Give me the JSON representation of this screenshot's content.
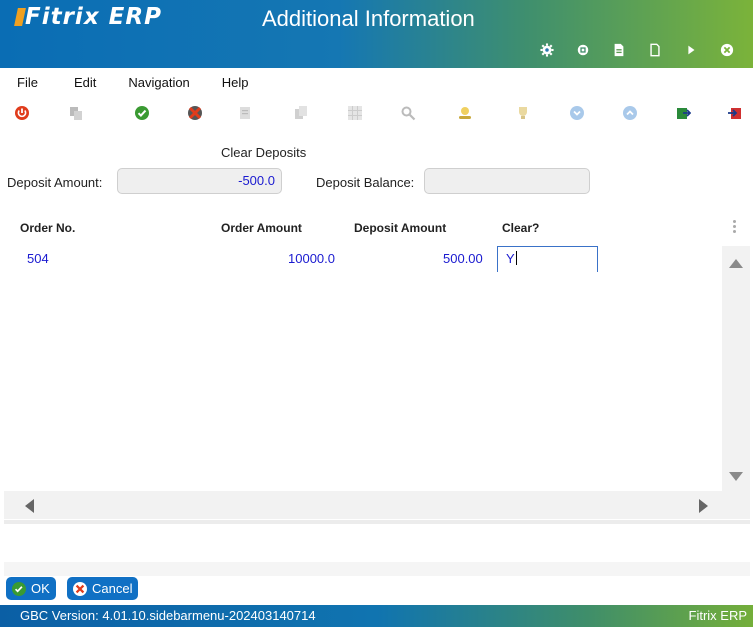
{
  "app": {
    "logo_text": "Fitrix ERP",
    "window_title": "Additional Information",
    "header_icons": [
      "gear-icon",
      "chip-icon",
      "document-filled-icon",
      "document-icon",
      "play-icon",
      "close-circle-icon"
    ]
  },
  "menu": {
    "items": [
      "File",
      "Edit",
      "Navigation",
      "Help"
    ]
  },
  "toolbar": {
    "buttons": [
      "power-icon",
      "copy-disabled-icon",
      "accept-icon",
      "cancel-icon",
      "paste-icon",
      "duplicate-icon",
      "grid-icon",
      "find-icon",
      "user-icon",
      "trophy-icon",
      "circle-down-icon",
      "circle-up-icon",
      "export-icon",
      "import-icon"
    ]
  },
  "form": {
    "section_title": "Clear Deposits",
    "deposit_amount_label": "Deposit Amount:",
    "deposit_amount_value": "-500.0",
    "deposit_balance_label": "Deposit Balance:",
    "deposit_balance_value": ""
  },
  "table": {
    "columns": [
      "Order No.",
      "Order Amount",
      "Deposit Amount",
      "Clear?"
    ],
    "rows": [
      {
        "order_no": "504",
        "order_amount": "10000.0",
        "deposit_amount": "500.00",
        "clear": "Y"
      }
    ]
  },
  "actions": {
    "ok_label": "OK",
    "cancel_label": "Cancel"
  },
  "status": {
    "version": "GBC Version: 4.01.10.sidebarmenu-202403140714",
    "brand": "Fitrix ERP"
  },
  "colors": {
    "accent_blue": "#1070c4",
    "value_blue": "#1a1ad0",
    "header_green": "#7bb33a"
  }
}
